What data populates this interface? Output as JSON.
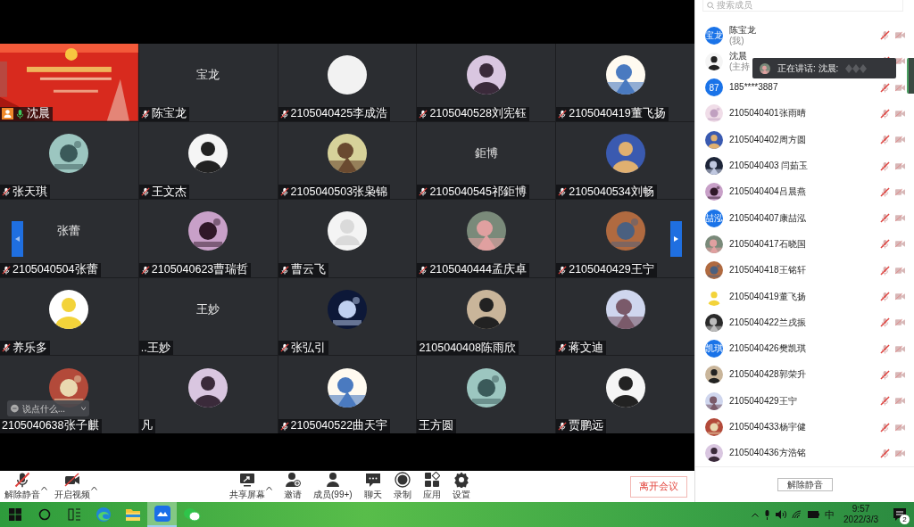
{
  "video_grid": {
    "tiles": [
      {
        "kind": "video",
        "name": "沈晨",
        "muted": false,
        "speaking": true,
        "host": true
      },
      {
        "kind": "text",
        "display": "宝龙",
        "name": "陈宝龙",
        "muted": true,
        "speaking": false,
        "host": false
      },
      {
        "kind": "blank",
        "name": "2105040425李成浩",
        "muted": true,
        "speaking": false,
        "host": false
      },
      {
        "kind": "avatar",
        "name": "2105040528刘宪钰",
        "muted": true,
        "speaking": false,
        "host": false
      },
      {
        "kind": "avatar",
        "name": "2105040419董飞扬",
        "muted": true,
        "speaking": false,
        "host": false
      },
      {
        "kind": "avatar",
        "name": "张天琪",
        "muted": true,
        "speaking": false,
        "host": false
      },
      {
        "kind": "avatar",
        "name": "王文杰",
        "muted": true,
        "speaking": false,
        "host": false
      },
      {
        "kind": "avatar",
        "name": "2105040503张枭锦",
        "muted": true,
        "speaking": false,
        "host": false
      },
      {
        "kind": "text",
        "display": "鉅博",
        "name": "2105040545祁鉅博",
        "muted": true,
        "speaking": false,
        "host": false
      },
      {
        "kind": "avatar",
        "name": "2105040534刘畅",
        "muted": true,
        "speaking": false,
        "host": false
      },
      {
        "kind": "text",
        "display": "张蕾",
        "name": "2105040504张蕾",
        "muted": true,
        "speaking": false,
        "host": false
      },
      {
        "kind": "avatar",
        "name": "2105040623曹瑞哲",
        "muted": true,
        "speaking": false,
        "host": false
      },
      {
        "kind": "default",
        "name": "曹云飞",
        "muted": true,
        "speaking": false,
        "host": false
      },
      {
        "kind": "avatar",
        "name": "2105040444孟庆卓",
        "muted": true,
        "speaking": false,
        "host": false
      },
      {
        "kind": "avatar",
        "name": "2105040429王宁",
        "muted": true,
        "speaking": false,
        "host": false
      },
      {
        "kind": "avatar",
        "name": "养乐多",
        "muted": true,
        "speaking": false,
        "host": false
      },
      {
        "kind": "text",
        "display": "王妙",
        "name": "..王妙",
        "muted": false,
        "speaking": false,
        "host": false
      },
      {
        "kind": "avatar",
        "name": "张弘引",
        "muted": true,
        "speaking": false,
        "host": false
      },
      {
        "kind": "avatar",
        "name": "2105040408陈雨欣",
        "muted": false,
        "speaking": false,
        "host": false
      },
      {
        "kind": "avatar",
        "name": "蒋文迪",
        "muted": true,
        "speaking": false,
        "host": false
      },
      {
        "kind": "avatar",
        "name": "2105040638张子麒",
        "muted": false,
        "speaking": false,
        "host": false
      },
      {
        "kind": "avatar",
        "name": "凡",
        "muted": false,
        "speaking": false,
        "host": false
      },
      {
        "kind": "avatar",
        "name": "2105040522曲天宇",
        "muted": true,
        "speaking": false,
        "host": false
      },
      {
        "kind": "avatar",
        "name": "王方圆",
        "muted": false,
        "speaking": false,
        "host": false
      },
      {
        "kind": "avatar",
        "name": "贾鹏远",
        "muted": true,
        "speaking": false,
        "host": false
      }
    ],
    "chat_input": {
      "placeholder": "说点什么..."
    }
  },
  "toolbar": {
    "tools": [
      {
        "kind": "mic",
        "label": "解除静音",
        "caret": true
      },
      {
        "kind": "video",
        "label": "开启视频",
        "caret": true
      },
      {
        "kind": "share",
        "label": "共享屏幕",
        "caret": true
      },
      {
        "kind": "invite",
        "label": "邀请",
        "caret": false
      },
      {
        "kind": "members",
        "label": "成员(99+)",
        "caret": false
      },
      {
        "kind": "chat",
        "label": "聊天",
        "caret": false
      },
      {
        "kind": "record",
        "label": "录制",
        "caret": false
      },
      {
        "kind": "apps",
        "label": "应用",
        "caret": false
      },
      {
        "kind": "settings",
        "label": "设置",
        "caret": false
      }
    ],
    "leave": "离开会议"
  },
  "members_panel": {
    "search": {
      "placeholder": "搜索成员"
    },
    "speaking_tooltip": "正在讲话: 沈晨:",
    "members": [
      {
        "name": "陈宝龙",
        "note": "(我)",
        "avatar_text": "宝龙"
      },
      {
        "name": "沈晨",
        "note": "(主持"
      },
      {
        "name": "185****3887",
        "avatar_text": "87"
      },
      {
        "name": "2105040401张雨晴"
      },
      {
        "name": "2105040402周方圆"
      },
      {
        "name": "2105040403 闫茹玉"
      },
      {
        "name": "2105040404吕晨燕"
      },
      {
        "name": "2105040407康喆泓",
        "avatar_text": "喆泓"
      },
      {
        "name": "2105040417石晓国"
      },
      {
        "name": "2105040418王铭轩"
      },
      {
        "name": "2105040419董飞扬"
      },
      {
        "name": "2105040422兰戌振"
      },
      {
        "name": "2105040426樊凯琪",
        "avatar_text": "凯琪"
      },
      {
        "name": "2105040428郭荣升"
      },
      {
        "name": "2105040429王宁"
      },
      {
        "name": "2105040433杨宇健"
      },
      {
        "name": "2105040436方浩铭"
      }
    ],
    "unmute_button": "解除静音"
  },
  "taskbar": {
    "apps": [
      {
        "kind": "start",
        "selected": false
      },
      {
        "kind": "search",
        "selected": false
      },
      {
        "kind": "taskview",
        "selected": false
      },
      {
        "kind": "browser",
        "selected": false
      },
      {
        "kind": "folder",
        "selected": false
      },
      {
        "kind": "meeting",
        "selected": true
      },
      {
        "kind": "wechat",
        "selected": false
      }
    ],
    "ime": "中",
    "time": "9:57",
    "date": "2022/3/3",
    "notifications": "2"
  }
}
